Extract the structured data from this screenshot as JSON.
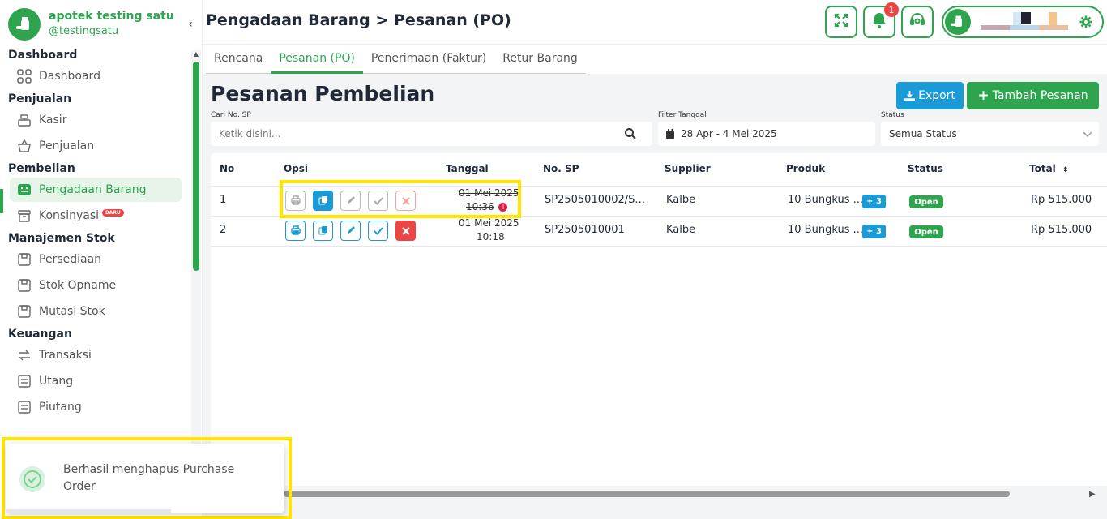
{
  "brand": {
    "name": "apotek testing satu",
    "username": "@testingsatu"
  },
  "sidebar": {
    "sections": [
      {
        "title": "Dashboard",
        "items": [
          {
            "label": "Dashboard",
            "icon": "grid-icon"
          }
        ]
      },
      {
        "title": "Penjualan",
        "items": [
          {
            "label": "Kasir",
            "icon": "cash-register-icon"
          },
          {
            "label": "Penjualan",
            "icon": "basket-icon"
          }
        ]
      },
      {
        "title": "Pembelian",
        "items": [
          {
            "label": "Pengadaan Barang",
            "icon": "procurement-icon",
            "active": true
          },
          {
            "label": "Konsinyasi",
            "icon": "archive-icon",
            "badge": "BARU"
          }
        ]
      },
      {
        "title": "Manajemen Stok",
        "items": [
          {
            "label": "Persediaan",
            "icon": "box-icon"
          },
          {
            "label": "Stok Opname",
            "icon": "box-icon"
          },
          {
            "label": "Mutasi Stok",
            "icon": "box-icon"
          }
        ]
      },
      {
        "title": "Keuangan",
        "items": [
          {
            "label": "Transaksi",
            "icon": "transfer-icon"
          },
          {
            "label": "Utang",
            "icon": "list-icon"
          },
          {
            "label": "Piutang",
            "icon": "list-icon"
          }
        ]
      }
    ]
  },
  "header": {
    "title": "Pengadaan Barang > Pesanan (PO)",
    "notification_count": "1"
  },
  "tabs": [
    "Rencana",
    "Pesanan (PO)",
    "Penerimaan (Faktur)",
    "Retur Barang"
  ],
  "active_tab": "Pesanan (PO)",
  "page": {
    "heading": "Pesanan Pembelian",
    "export_label": "Export",
    "add_label": "Tambah Pesanan"
  },
  "filters": {
    "search_label": "Cari No. SP",
    "search_placeholder": "Ketik disini...",
    "date_label": "Filter Tanggal",
    "date_value": "28 Apr - 4 Mei 2025",
    "status_label": "Status",
    "status_value": "Semua Status"
  },
  "table": {
    "headers": {
      "no": "No",
      "opsi": "Opsi",
      "tanggal": "Tanggal",
      "no_sp": "No. SP",
      "supplier": "Supplier",
      "produk": "Produk",
      "status": "Status",
      "total": "Total"
    },
    "rows": [
      {
        "no": "1",
        "date": "01 Mei 2025",
        "time": "10:36",
        "no_sp": "SP2505010002/S...",
        "supplier": "Kalbe",
        "produk": "10 Bungkus ...",
        "extra": "+ 3",
        "status": "Open",
        "total": "Rp 515.000",
        "deleted": true
      },
      {
        "no": "2",
        "date": "01 Mei 2025",
        "time": "10:18",
        "no_sp": "SP2505010001",
        "supplier": "Kalbe",
        "produk": "10 Bungkus ...",
        "extra": "+ 3",
        "status": "Open",
        "total": "Rp 515.000",
        "deleted": false
      }
    ]
  },
  "toast": {
    "message": "Berhasil menghapus Purchase Order"
  },
  "colors": {
    "brand": "#2ea44f",
    "accent": "#1a9bd7",
    "danger": "#ef4444",
    "highlight": "#ffe600"
  }
}
